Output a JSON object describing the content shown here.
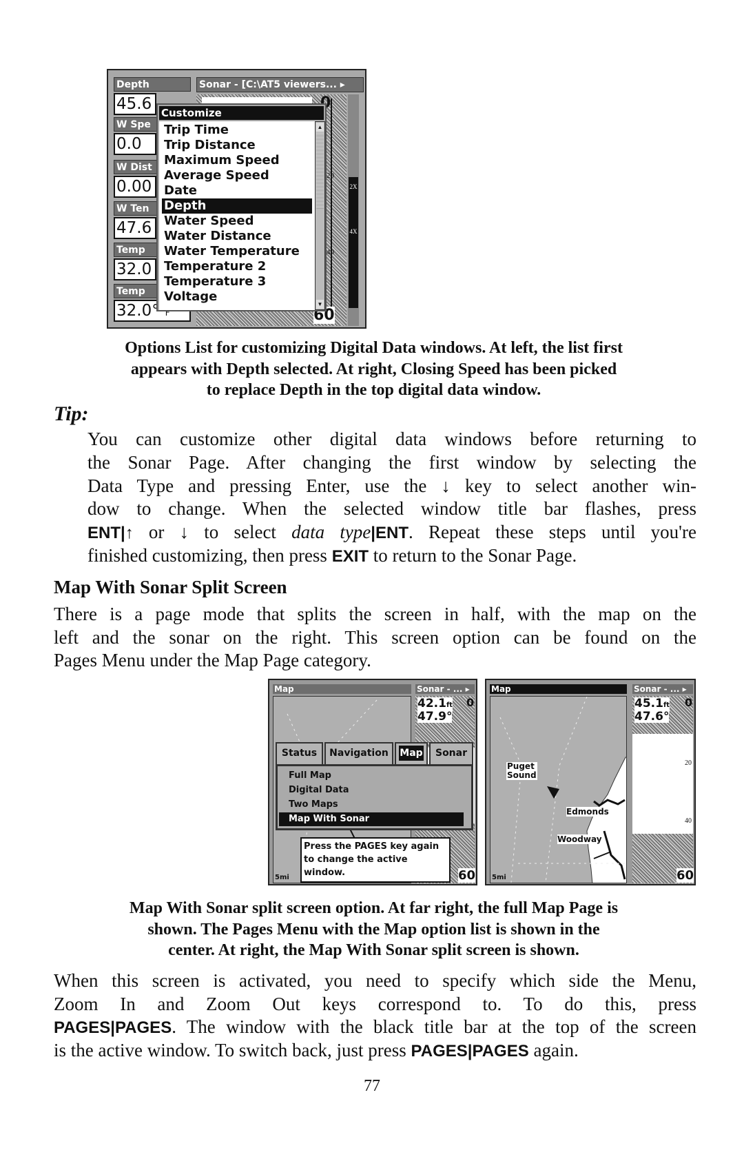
{
  "figure1": {
    "data_windows": [
      {
        "label": "Depth",
        "value": "45.6"
      },
      {
        "label": "W Spe",
        "value": "0.0"
      },
      {
        "label": "W Dist",
        "value": "0.00"
      },
      {
        "label": "W Ten",
        "value": "47.6"
      },
      {
        "label": "Temp",
        "value": "32.0"
      },
      {
        "label": "Temp",
        "value": "32.0°",
        "unit": "F"
      }
    ],
    "sonar_title": "Sonar - [C:\\AT5 viewers... ▸",
    "depth_scale": [
      "0",
      "20",
      "40",
      "60"
    ],
    "zoom_labels": [
      "2X",
      "4X"
    ],
    "menu_title": "Customize",
    "menu_items": [
      "Trip Time",
      "Trip Distance",
      "Maximum Speed",
      "Average Speed",
      "Date",
      "Depth",
      "Water Speed",
      "Water Distance",
      "Water Temperature",
      "Temperature 2",
      "Temperature 3",
      "Voltage"
    ],
    "selected_item": "Depth"
  },
  "caption1": [
    "Options List for customizing Digital Data windows. At left, the list first",
    "appears with Depth selected. At right, Closing Speed has been picked",
    "to replace Depth in the top digital data window."
  ],
  "tip_heading": "Tip:",
  "tip_lines": [
    {
      "justify": true,
      "segs": [
        {
          "t": "You can customize other digital data windows before returning to"
        }
      ]
    },
    {
      "justify": true,
      "segs": [
        {
          "t": "the Sonar Page. After changing the first window by selecting the"
        }
      ]
    },
    {
      "justify": true,
      "segs": [
        {
          "t": "Data Type and pressing Enter, use the ↓ key to select another win-"
        }
      ]
    },
    {
      "justify": true,
      "segs": [
        {
          "t": "dow to change. When the selected window title bar flashes, press"
        }
      ]
    },
    {
      "justify": true,
      "segs": [
        {
          "t": "ENT|↑",
          "s": "key"
        },
        {
          "t": " or ↓ to select "
        },
        {
          "t": "data type",
          "s": "it"
        },
        {
          "t": "|ENT",
          "s": "key"
        },
        {
          "t": ". Repeat these steps until you're"
        }
      ]
    },
    {
      "justify": false,
      "segs": [
        {
          "t": "finished customizing, then press "
        },
        {
          "t": "EXIT",
          "s": "key"
        },
        {
          "t": " to return to the Sonar Page."
        }
      ]
    }
  ],
  "section_heading": "Map With Sonar Split Screen",
  "para1_lines": [
    {
      "justify": true,
      "segs": [
        {
          "t": "There is a page mode that splits the screen in half, with the map on the"
        }
      ]
    },
    {
      "justify": true,
      "segs": [
        {
          "t": "left and the sonar on the right. This screen option can be found on the"
        }
      ]
    },
    {
      "justify": false,
      "segs": [
        {
          "t": "Pages Menu under the Map Page category."
        }
      ]
    }
  ],
  "figure2": {
    "left": {
      "map_title": "Map",
      "sonar_title": "Sonar - ... ▸",
      "depth": "42.1",
      "depth_unit": "ft",
      "temp": "47.9°",
      "scale_top": "0",
      "scale_bottom": "60",
      "map_scale": "5mi",
      "tabs": [
        "Status",
        "Navigation",
        "Map",
        "Sonar"
      ],
      "active_tab": "Map",
      "menu_items": [
        "Full Map",
        "Digital Data",
        "Two Maps",
        "Map With Sonar"
      ],
      "selected_item": "Map With Sonar",
      "tooltip": [
        "Press the PAGES key again",
        "to change the active",
        "window."
      ]
    },
    "right": {
      "map_title": "Map",
      "sonar_title": "Sonar - ... ▸",
      "depth": "45.1",
      "depth_unit": "ft",
      "temp": "47.6°",
      "scale": [
        "0",
        "20",
        "40",
        "60"
      ],
      "map_scale": "5mi",
      "places": [
        "Puget",
        "Sound",
        "Edmonds",
        "Woodway"
      ]
    }
  },
  "caption2": [
    "Map With Sonar split screen option. At far right, the full Map Page is",
    "shown. The Pages Menu with the Map option list is shown in the",
    "center. At right, the Map With Sonar split screen is shown."
  ],
  "para2_lines": [
    {
      "justify": true,
      "segs": [
        {
          "t": "When this screen is activated, you need to specify which side the Menu,"
        }
      ]
    },
    {
      "justify": true,
      "segs": [
        {
          "t": "Zoom In and Zoom Out keys correspond to. To do this, press"
        }
      ]
    },
    {
      "justify": true,
      "segs": [
        {
          "t": "PAGES|PAGES",
          "s": "key"
        },
        {
          "t": ". The window with the black title bar at the top of the screen"
        }
      ]
    },
    {
      "justify": false,
      "segs": [
        {
          "t": "is the active window. To switch back, just press "
        },
        {
          "t": "PAGES|PAGES",
          "s": "key"
        },
        {
          "t": " again."
        }
      ]
    }
  ],
  "page_number": "77"
}
